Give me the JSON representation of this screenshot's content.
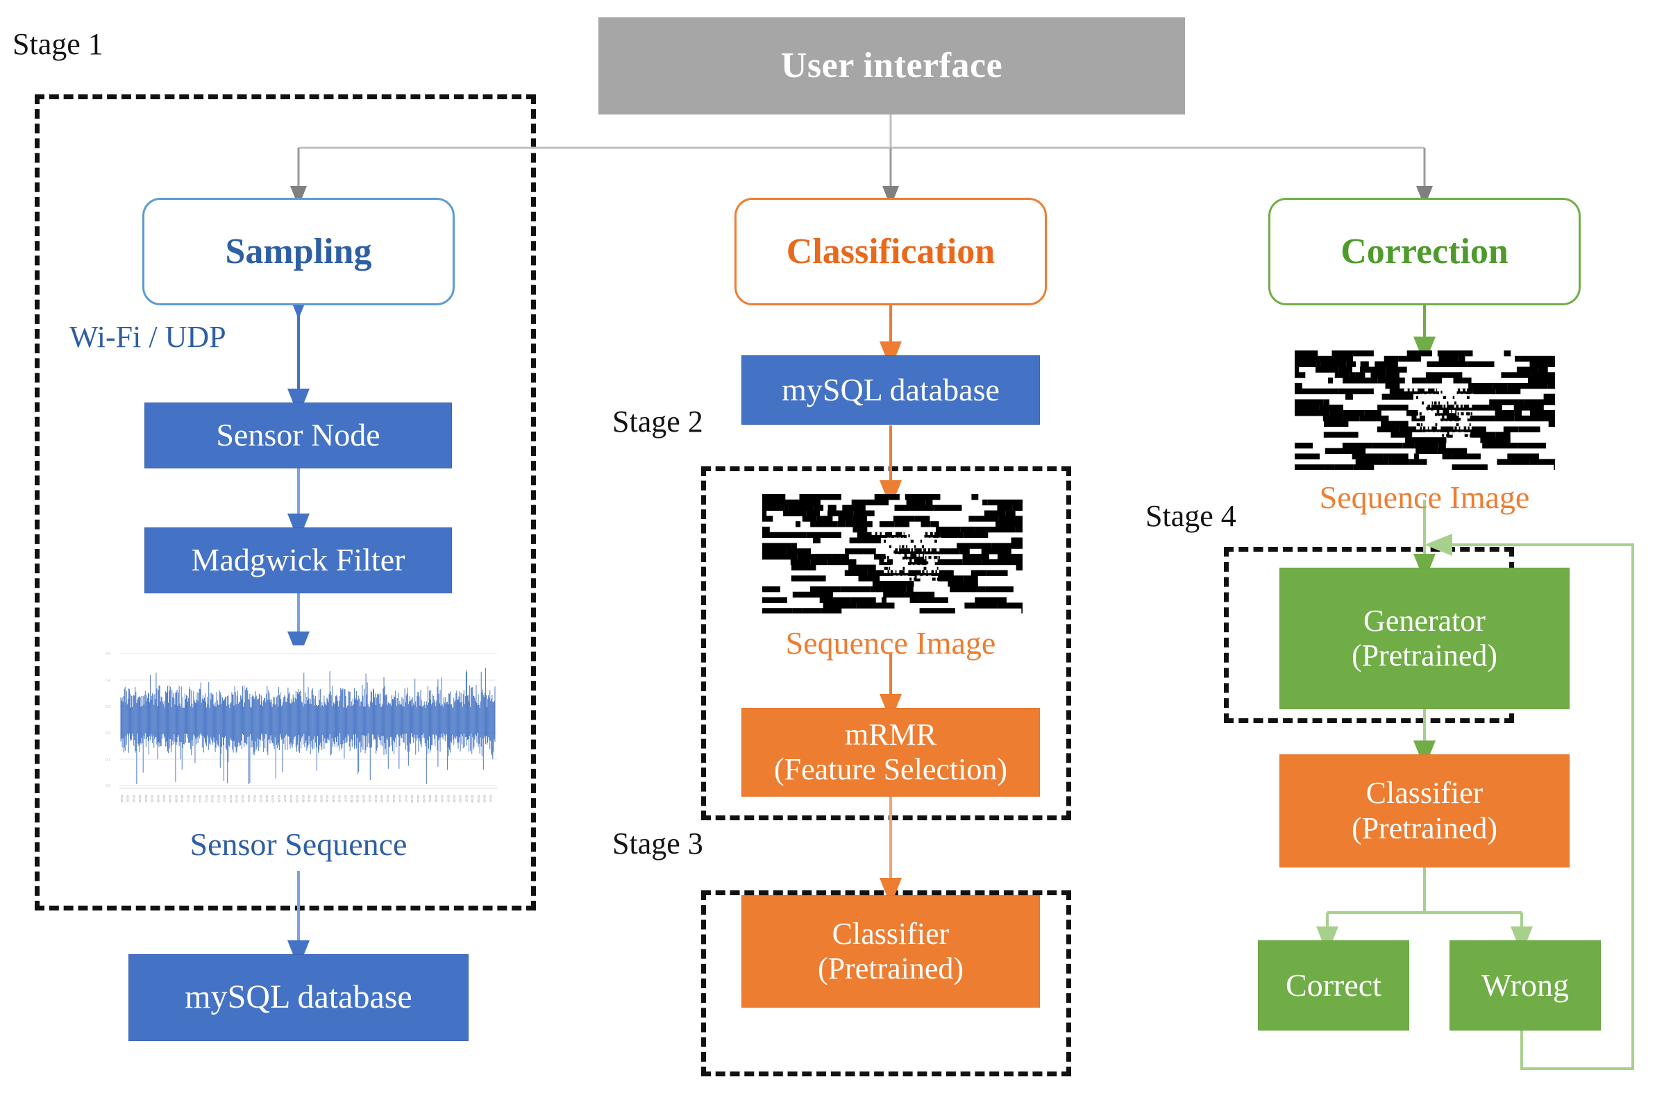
{
  "diagram": {
    "title_bar": {
      "label": "User interface",
      "color": "#A6A6A6",
      "text_color": "#FFFFFF"
    },
    "stages": [
      {
        "id": "stage1",
        "label": "Stage 1"
      },
      {
        "id": "stage2",
        "label": "Stage 2"
      },
      {
        "id": "stage3",
        "label": "Stage 3"
      },
      {
        "id": "stage4",
        "label": "Stage 4"
      }
    ],
    "columns": [
      {
        "id": "sampling",
        "header": "Sampling",
        "accent": "#4472C4",
        "header_text_color": "#2E5FA3",
        "nodes": [
          {
            "id": "sensor-node",
            "label": "Sensor Node",
            "fill": "#4472C4"
          },
          {
            "id": "madgwick-filter",
            "label": "Madgwick Filter",
            "fill": "#4472C4"
          },
          {
            "id": "mysql-db-left",
            "label": "mySQL database",
            "fill": "#4472C4"
          }
        ],
        "captions": [
          {
            "id": "wifi-udp",
            "label": "Wi-Fi / UDP",
            "color": "#2E5FA3"
          },
          {
            "id": "sensor-sequence",
            "label": "Sensor Sequence",
            "color": "#2E5FA3"
          }
        ]
      },
      {
        "id": "classification",
        "header": "Classification",
        "accent": "#ED7D31",
        "header_text_color": "#ED7D31",
        "nodes": [
          {
            "id": "mysql-db-mid",
            "label": "mySQL database",
            "fill": "#4472C4"
          },
          {
            "id": "mrmr",
            "label_line1": "mRMR",
            "label_line2": "(Feature Selection)",
            "fill": "#ED7D31"
          },
          {
            "id": "classifier-stage3",
            "label_line1": "Classifier",
            "label_line2": "(Pretrained)",
            "fill": "#ED7D31"
          }
        ],
        "captions": [
          {
            "id": "sequence-image-mid",
            "label": "Sequence Image",
            "color": "#ED7D31"
          }
        ]
      },
      {
        "id": "correction",
        "header": "Correction",
        "accent": "#70AD47",
        "header_text_color": "#4E9A2A",
        "nodes": [
          {
            "id": "generator",
            "label_line1": "Generator",
            "label_line2": "(Pretrained)",
            "fill": "#70AD47"
          },
          {
            "id": "classifier-stage4",
            "label_line1": "Classifier",
            "label_line2": "(Pretrained)",
            "fill": "#ED7D31"
          },
          {
            "id": "correct",
            "label": "Correct",
            "fill": "#70AD47"
          },
          {
            "id": "wrong",
            "label": "Wrong",
            "fill": "#70AD47"
          }
        ],
        "captions": [
          {
            "id": "sequence-image-right",
            "label": "Sequence Image",
            "color": "#ED7D31"
          }
        ]
      }
    ],
    "colors": {
      "blue": "#4472C4",
      "blue_light": "#5B9BD5",
      "orange": "#ED7D31",
      "green": "#70AD47",
      "gray": "#A6A6A6",
      "dash_black": "#111111"
    }
  }
}
